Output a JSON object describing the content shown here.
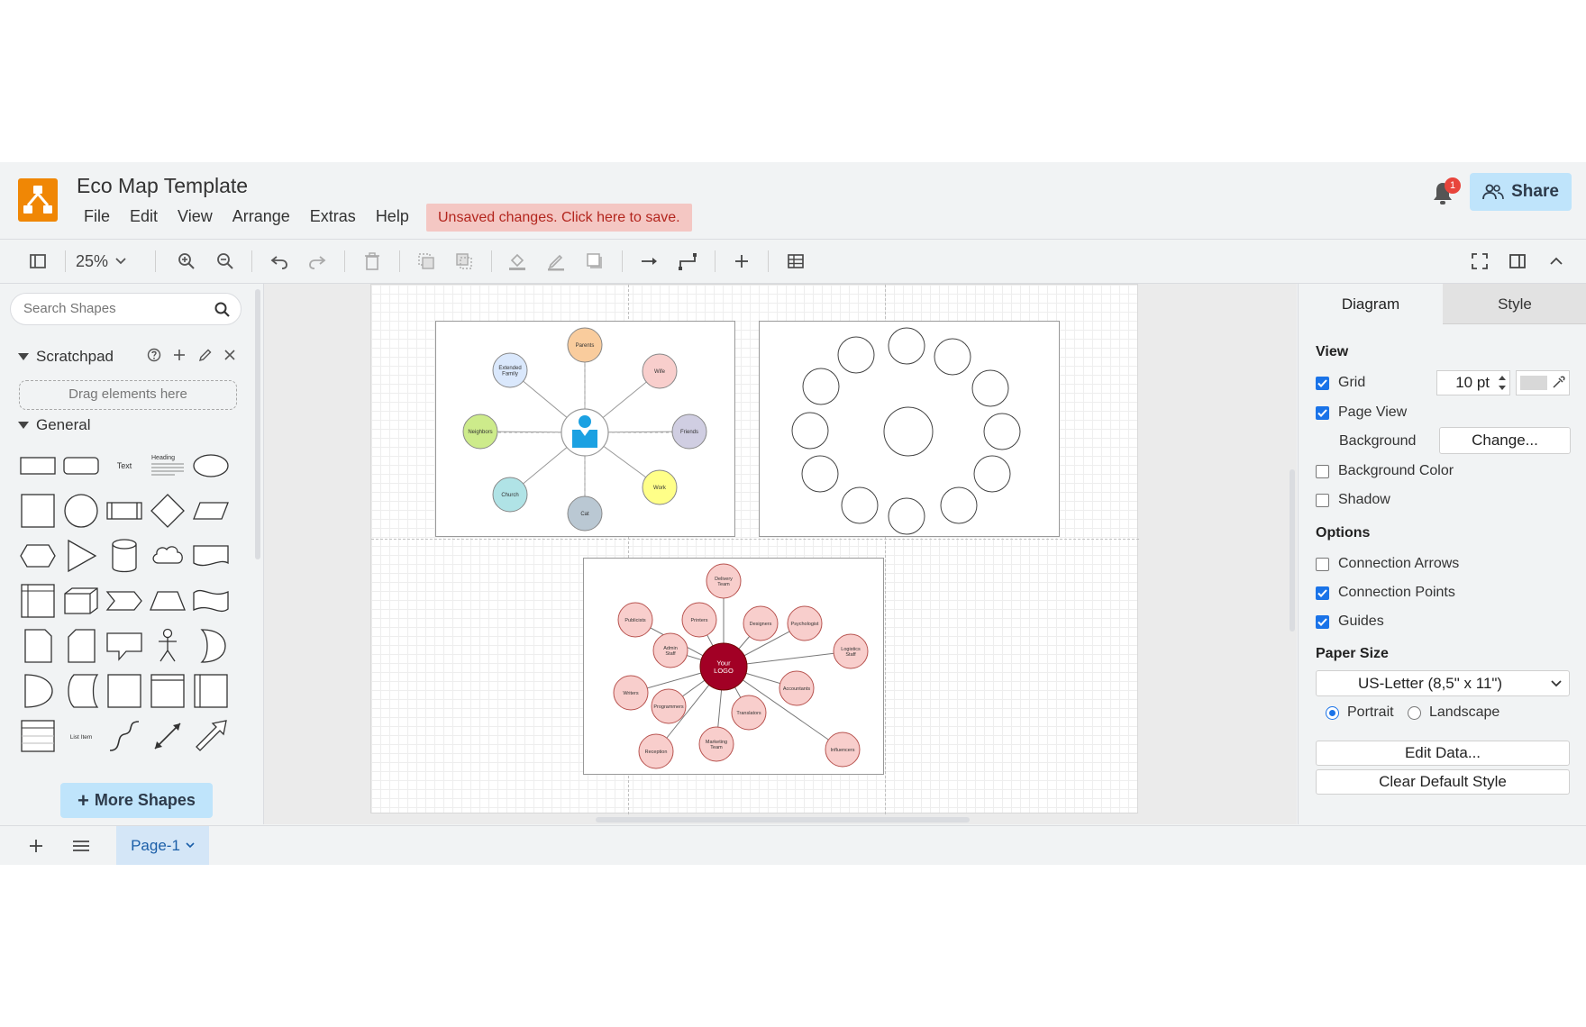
{
  "app": {
    "title": "Eco Map Template",
    "menus": [
      "File",
      "Edit",
      "View",
      "Arrange",
      "Extras",
      "Help"
    ],
    "unsaved_notice": "Unsaved changes. Click here to save.",
    "notification_count": "1",
    "share_label": "Share",
    "accent": "#f08705"
  },
  "toolbar": {
    "zoom": "25%"
  },
  "sidebar": {
    "search_placeholder": "Search Shapes",
    "scratchpad_title": "Scratchpad",
    "dropzone_text": "Drag elements here",
    "general_title": "General",
    "shape_labels": {
      "text": "Text",
      "heading": "Heading",
      "list_item": "List Item"
    },
    "more_shapes": "More Shapes"
  },
  "diagram1": {
    "labels": [
      "Parents",
      "Wife",
      "Friends",
      "Work",
      "Cat",
      "Church",
      "Neighbors",
      "Extended Family"
    ],
    "colors": [
      "#f9cc9d",
      "#f8cecc",
      "#d0cee2",
      "#ffff88",
      "#bac8d3",
      "#b0e3e6",
      "#cdeb8b",
      "#dae8fc"
    ]
  },
  "diagram3": {
    "center": "Your LOGO",
    "labels": [
      "Delivery Team",
      "Printers",
      "Designers",
      "Psychologist",
      "Logistics Staff",
      "Accountants",
      "Influencers",
      "Translators",
      "Marketing Team",
      "Reception",
      "Programmers",
      "Writers",
      "Admin Staff",
      "Publicists"
    ],
    "node_color": "#f8cecc",
    "center_color": "#a20025"
  },
  "panel": {
    "tab_diagram": "Diagram",
    "tab_style": "Style",
    "view_title": "View",
    "grid": "Grid",
    "grid_size": "10 pt",
    "page_view": "Page View",
    "background": "Background",
    "change_btn": "Change...",
    "background_color": "Background Color",
    "shadow": "Shadow",
    "options_title": "Options",
    "connection_arrows": "Connection Arrows",
    "connection_points": "Connection Points",
    "guides": "Guides",
    "paper_size_title": "Paper Size",
    "paper_size": "US-Letter (8,5\" x 11\")",
    "portrait": "Portrait",
    "landscape": "Landscape",
    "edit_data": "Edit Data...",
    "clear_style": "Clear Default Style"
  },
  "footer": {
    "page_tab": "Page-1"
  }
}
